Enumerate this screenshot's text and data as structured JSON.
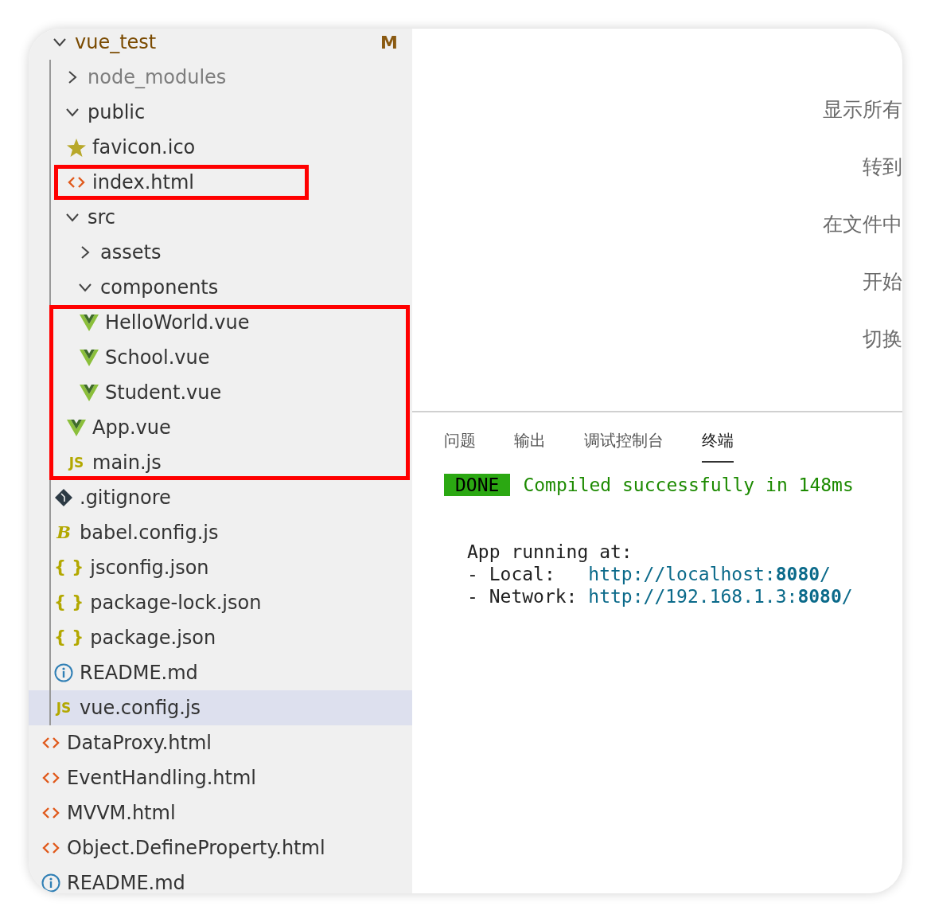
{
  "explorer": {
    "tree": [
      {
        "kind": "folder",
        "label": "vue_test",
        "expanded": true,
        "modified": true,
        "badge": "M",
        "children": [
          {
            "kind": "folder",
            "label": "node_modules",
            "expanded": false,
            "ignored": true
          },
          {
            "kind": "folder",
            "label": "public",
            "expanded": true,
            "children": [
              {
                "kind": "image",
                "label": "favicon.ico"
              },
              {
                "kind": "html",
                "label": "index.html",
                "highlighted": true
              }
            ]
          },
          {
            "kind": "folder",
            "label": "src",
            "expanded": true,
            "children": [
              {
                "kind": "folder",
                "label": "assets",
                "expanded": false
              },
              {
                "kind": "folder",
                "label": "components",
                "expanded": true,
                "children": [
                  {
                    "kind": "vue",
                    "label": "HelloWorld.vue",
                    "highlighted": true
                  },
                  {
                    "kind": "vue",
                    "label": "School.vue",
                    "highlighted": true
                  },
                  {
                    "kind": "vue",
                    "label": "Student.vue",
                    "highlighted": true
                  }
                ]
              },
              {
                "kind": "vue",
                "label": "App.vue",
                "highlighted": true
              },
              {
                "kind": "js",
                "label": "main.js",
                "icon_label": "JS",
                "highlighted": true
              }
            ]
          },
          {
            "kind": "git",
            "label": ".gitignore"
          },
          {
            "kind": "babel",
            "label": "babel.config.js",
            "icon_label": "B"
          },
          {
            "kind": "json",
            "label": "jsconfig.json",
            "icon_label": "{ }"
          },
          {
            "kind": "json",
            "label": "package-lock.json",
            "icon_label": "{ }"
          },
          {
            "kind": "json",
            "label": "package.json",
            "icon_label": "{ }"
          },
          {
            "kind": "info",
            "label": "README.md"
          },
          {
            "kind": "js",
            "label": "vue.config.js",
            "icon_label": "JS",
            "selected": true
          }
        ]
      },
      {
        "kind": "html",
        "label": "DataProxy.html"
      },
      {
        "kind": "html",
        "label": "EventHandling.html"
      },
      {
        "kind": "html",
        "label": "MVVM.html"
      },
      {
        "kind": "html",
        "label": "Object.DefineProperty.html"
      },
      {
        "kind": "info",
        "label": "README.md"
      }
    ]
  },
  "editor": {
    "commands": [
      "显示所有",
      "转到",
      "在文件中",
      "开始",
      "切换"
    ]
  },
  "panel": {
    "tabs": [
      {
        "label": "问题",
        "selected": false
      },
      {
        "label": "输出",
        "selected": false
      },
      {
        "label": "调试控制台",
        "selected": false
      },
      {
        "label": "终端",
        "selected": true
      }
    ],
    "terminal": {
      "status_badge": "DONE",
      "status_message": "Compiled successfully in 148ms",
      "heading": "App running at:",
      "addresses": [
        {
          "label": "- Local:",
          "url": "http://localhost:**8080**/"
        },
        {
          "label": "- Network:",
          "url": "http://192.168.1.3:**8080**/"
        }
      ]
    }
  }
}
